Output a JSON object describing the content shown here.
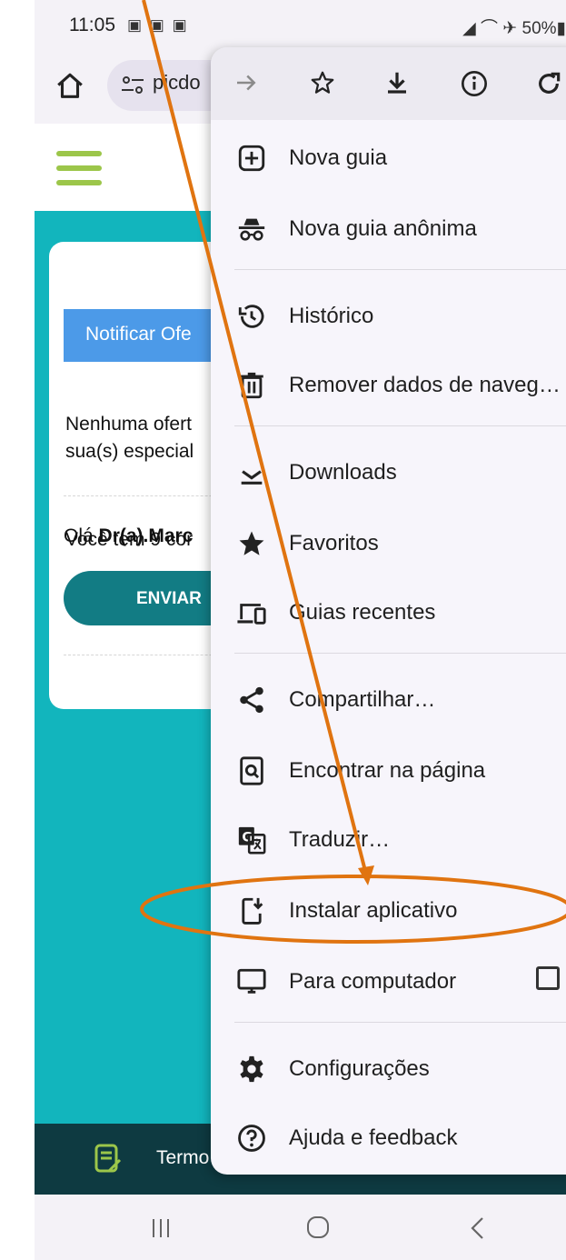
{
  "status_bar": {
    "time": "11:05",
    "battery": "50%"
  },
  "browser": {
    "url": "picdo"
  },
  "page": {
    "greeting_prefix": "Olá",
    "greeting_name": "Dr(a).Marc",
    "notify_button": "Notificar Ofe",
    "empty_text_line1": "Nenhuma ofert",
    "empty_text_line2": "sua(s) especial",
    "consults_text": "Você tem 9 cor",
    "send_button": "ENVIAR",
    "footer_text": "Termo"
  },
  "menu": {
    "toolbar": [
      "forward-icon",
      "star-icon",
      "download-icon",
      "info-icon",
      "refresh-icon"
    ],
    "items": {
      "new_tab": "Nova guia",
      "incognito": "Nova guia anônima",
      "history": "Histórico",
      "clear_data": "Remover dados de naveg…",
      "downloads": "Downloads",
      "bookmarks": "Favoritos",
      "recent_tabs": "Guias recentes",
      "share": "Compartilhar…",
      "find": "Encontrar na página",
      "translate": "Traduzir…",
      "install": "Instalar aplicativo",
      "desktop": "Para computador",
      "settings": "Configurações",
      "help": "Ajuda e feedback"
    },
    "desktop_checked": false
  },
  "annotation_color": "#e07410"
}
